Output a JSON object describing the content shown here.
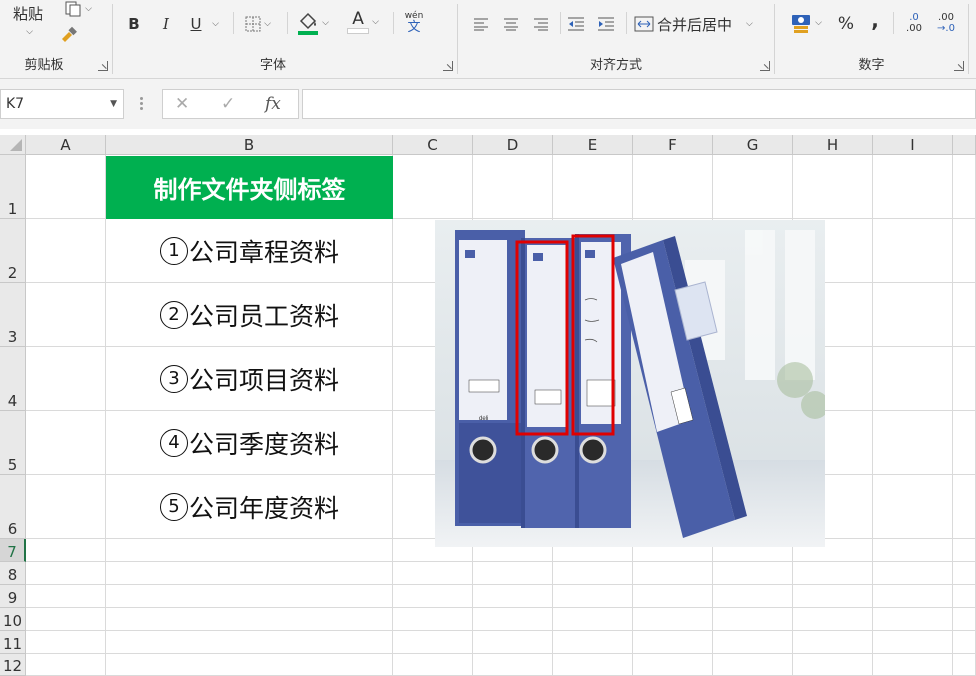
{
  "ribbon": {
    "clipboard": {
      "paste_label": "粘贴",
      "group_label": "剪贴板"
    },
    "font": {
      "group_label": "字体",
      "bold": "B",
      "italic": "I",
      "underline": "U",
      "font_color_letter": "A",
      "phonetic_top": "wén",
      "phonetic_bottom": "文",
      "font_color": "#ff0000",
      "fill_color": "#00b050"
    },
    "alignment": {
      "group_label": "对齐方式",
      "merge_label": "合并后居中"
    },
    "number": {
      "group_label": "数字",
      "percent": "%",
      "comma": ",",
      "inc_decimal_top": ".0",
      "inc_decimal_bottom": ".00",
      "dec_decimal_top": ".00",
      "dec_decimal_bottom": "→.0"
    }
  },
  "formula_bar": {
    "name_box": "K7",
    "cancel": "✕",
    "enter": "✓",
    "fx": "fx",
    "value": ""
  },
  "columns": [
    "A",
    "B",
    "C",
    "D",
    "E",
    "F",
    "G",
    "H",
    "I"
  ],
  "rows": [
    "1",
    "2",
    "3",
    "4",
    "5",
    "6",
    "7",
    "8",
    "9",
    "10",
    "11",
    "12"
  ],
  "selected_row": "7",
  "sheet": {
    "title": "制作文件夹侧标签",
    "items": [
      {
        "num": "1",
        "text": "公司章程资料"
      },
      {
        "num": "2",
        "text": "公司员工资料"
      },
      {
        "num": "3",
        "text": "公司项目资料"
      },
      {
        "num": "4",
        "text": "公司季度资料"
      },
      {
        "num": "5",
        "text": "公司年度资料"
      }
    ],
    "title_color": "#00b050"
  },
  "picture": {
    "brand_label": "deli",
    "highlight_color": "#e00000",
    "folder_color": "#4a5fa8"
  }
}
